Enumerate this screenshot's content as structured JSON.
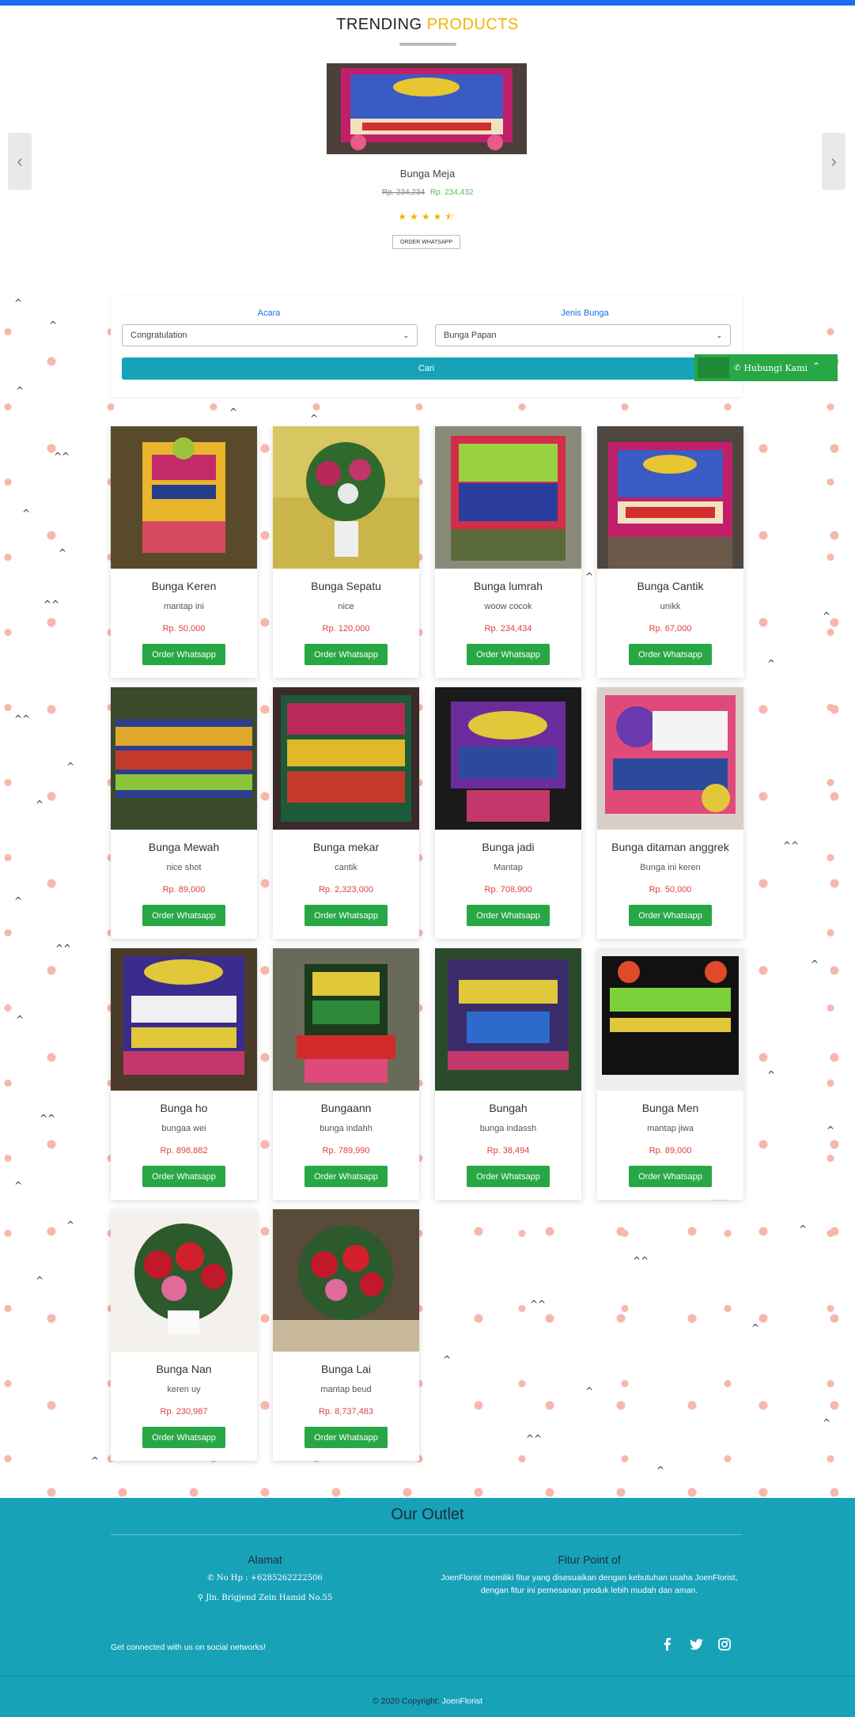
{
  "trending": {
    "title_part1": "TRENDING",
    "title_part2": "PRODUCTS",
    "prev_icon": "chevron-left-icon",
    "next_icon": "chevron-right-icon",
    "product": {
      "name": "Bunga Meja",
      "old_price": "Rp. 234,234",
      "price": "Rp. 234,432",
      "rating": 4.5,
      "order_label": "ORDER WHATSAPP"
    }
  },
  "filter": {
    "acara_label": "Acara",
    "acara_value": "Congratulation",
    "jenis_label": "Jenis Bunga",
    "jenis_value": "Bunga Papan",
    "search_label": "Cari"
  },
  "contact_button": {
    "label": "Hubungi Kami",
    "icon": "phone-icon"
  },
  "products": [
    {
      "name": "Bunga Keren",
      "desc": "mantap ini",
      "price": "Rp. 50,000",
      "order": "Order Whatsapp"
    },
    {
      "name": "Bunga Sepatu",
      "desc": "nice",
      "price": "Rp. 120,000",
      "order": "Order Whatsapp"
    },
    {
      "name": "Bunga lumrah",
      "desc": "woow cocok",
      "price": "Rp. 234,434",
      "order": "Order Whatsapp"
    },
    {
      "name": "Bunga Cantik",
      "desc": "unikk",
      "price": "Rp. 67,000",
      "order": "Order Whatsapp"
    },
    {
      "name": "Bunga Mewah",
      "desc": "nice shot",
      "price": "Rp. 89,000",
      "order": "Order Whatsapp"
    },
    {
      "name": "Bunga mekar",
      "desc": "cantik",
      "price": "Rp. 2,323,000",
      "order": "Order Whatsapp"
    },
    {
      "name": "Bunga jadi",
      "desc": "Mantap",
      "price": "Rp. 708,900",
      "order": "Order Whatsapp"
    },
    {
      "name": "Bunga ditaman anggrek",
      "desc": "Bunga ini keren",
      "price": "Rp. 50,000",
      "order": "Order Whatsapp"
    },
    {
      "name": "Bunga ho",
      "desc": "bungaa wei",
      "price": "Rp. 898,882",
      "order": "Order Whatsapp"
    },
    {
      "name": "Bungaann",
      "desc": "bunga indahh",
      "price": "Rp. 789,990",
      "order": "Order Whatsapp"
    },
    {
      "name": "Bungah",
      "desc": "bunga indassh",
      "price": "Rp. 38,494",
      "order": "Order Whatsapp"
    },
    {
      "name": "Bunga Men",
      "desc": "mantap jiwa",
      "price": "Rp. 89,000",
      "order": "Order Whatsapp"
    },
    {
      "name": "Bunga Nan",
      "desc": "keren uy",
      "price": "Rp. 230,987",
      "order": "Order Whatsapp"
    },
    {
      "name": "Bunga Lai",
      "desc": "mantap beud",
      "price": "Rp. 8,737,483",
      "order": "Order Whatsapp"
    }
  ],
  "footer": {
    "outlet_title": "Our Outlet",
    "alamat_title": "Alamat",
    "phone": "No Hp : +6285262222506",
    "address": "Jln. Brigjend Zein Hamid No.55",
    "fitur_title": "Fitur Point of",
    "fitur_text": "JoenFlorist memiliki fitur yang disesuaikan dengan kebutuhan usaha JoenFlorist, dengan fitur ini pemesanan produk lebih mudah dan aman.",
    "social_text": "Get connected with us on social networks!",
    "social": [
      "facebook-icon",
      "twitter-icon",
      "instagram-icon"
    ],
    "copyright_prefix": "© 2020 Copyright:",
    "copyright_brand": "JoenFlorist"
  },
  "colors": {
    "accent_blue": "#1a6cf0",
    "title_accent": "#f4b400",
    "teal": "#17a2b8",
    "whatsapp_green": "#28a745",
    "price_red": "#e04040"
  }
}
